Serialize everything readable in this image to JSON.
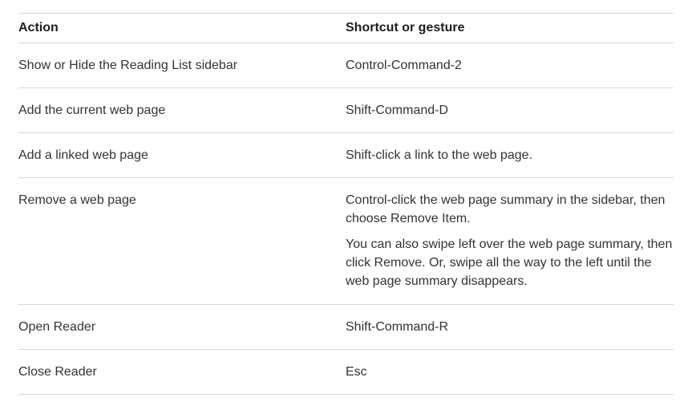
{
  "table": {
    "headers": {
      "action": "Action",
      "shortcut": "Shortcut or gesture"
    },
    "rows": [
      {
        "action": "Show or Hide the Reading List sidebar",
        "shortcut": [
          "Control-Command-2"
        ]
      },
      {
        "action": "Add the current web page",
        "shortcut": [
          "Shift-Command-D"
        ]
      },
      {
        "action": "Add a linked web page",
        "shortcut": [
          "Shift-click a link to the web page."
        ]
      },
      {
        "action": "Remove a web page",
        "shortcut": [
          "Control-click the web page summary in the sidebar, then choose Remove Item.",
          "You can also swipe left over the web page summary, then click Remove. Or, swipe all the way to the left until the web page summary disappears."
        ]
      },
      {
        "action": "Open Reader",
        "shortcut": [
          "Shift-Command-R"
        ]
      },
      {
        "action": "Close Reader",
        "shortcut": [
          "Esc"
        ]
      }
    ]
  }
}
